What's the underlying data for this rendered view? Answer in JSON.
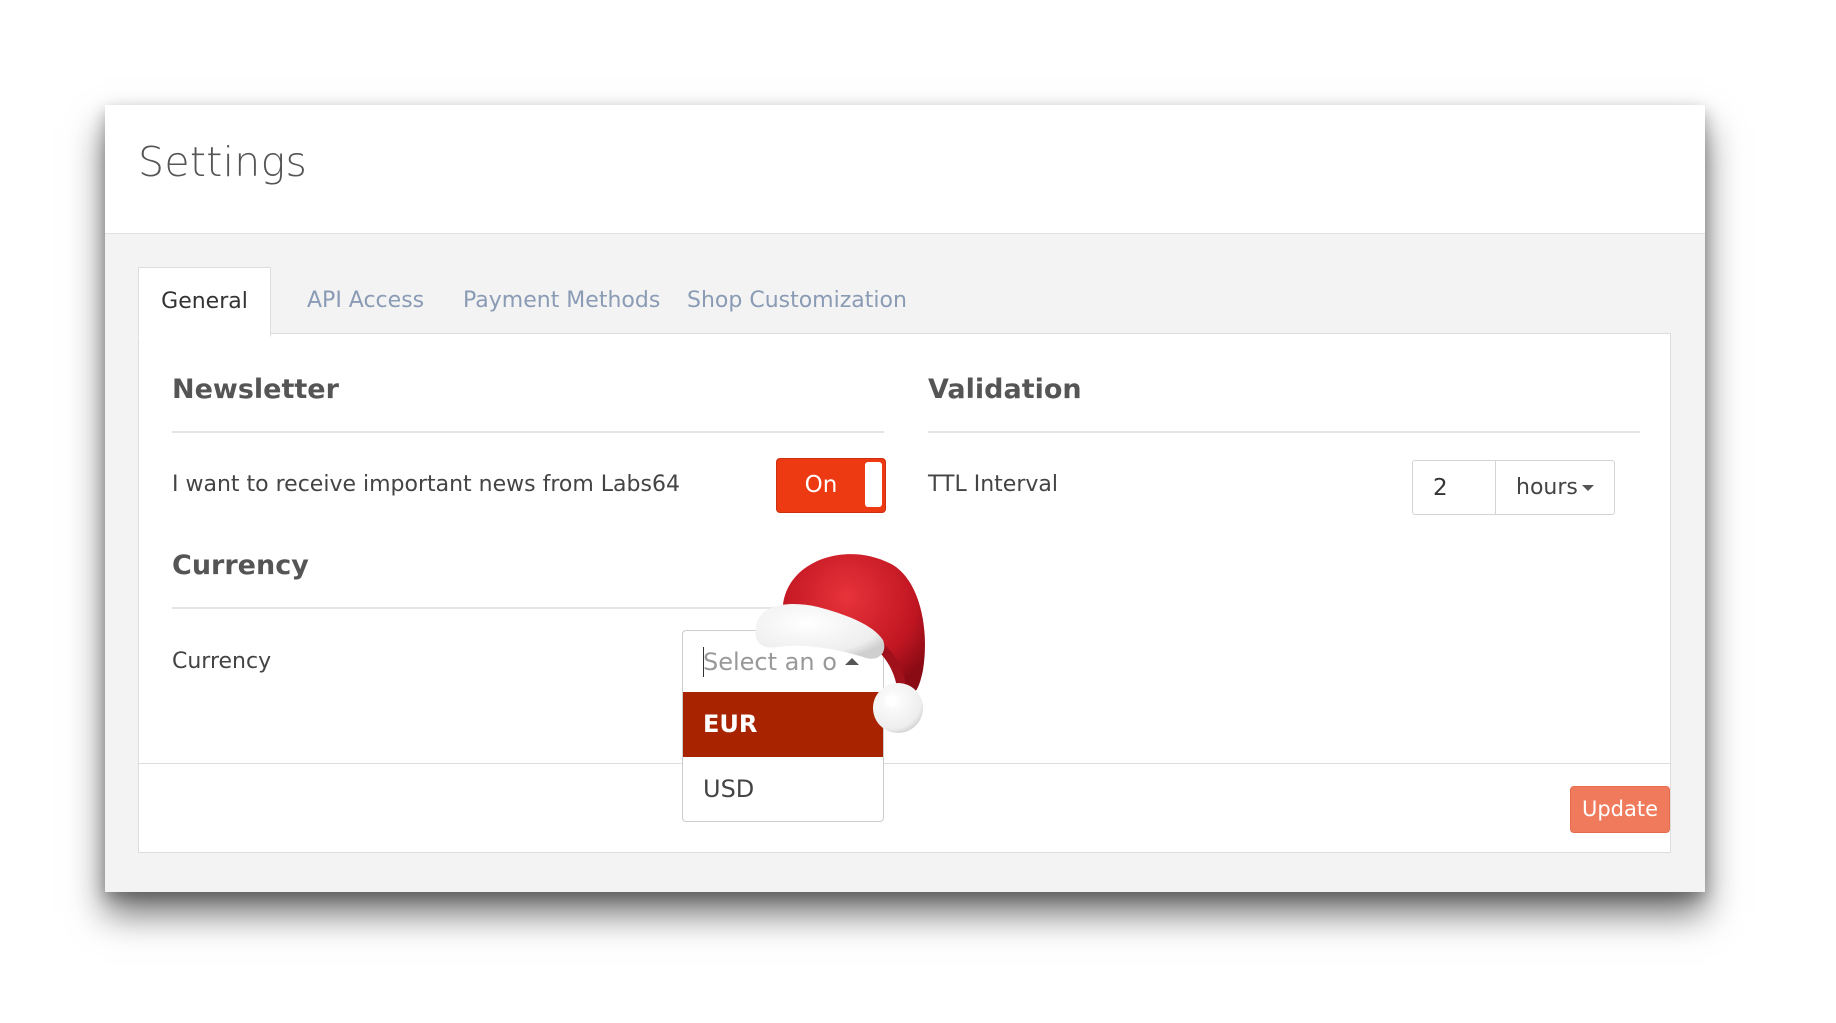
{
  "page": {
    "title": "Settings"
  },
  "tabs": [
    {
      "label": "General",
      "active": true
    },
    {
      "label": "API Access",
      "active": false
    },
    {
      "label": "Payment Methods",
      "active": false
    },
    {
      "label": "Shop Customization",
      "active": false
    }
  ],
  "newsletter": {
    "title": "Newsletter",
    "label": "I want to receive important news from Labs64",
    "toggle_label": "On"
  },
  "validation": {
    "title": "Validation",
    "label": "TTL Interval",
    "ttl_value": "2",
    "unit": "hours"
  },
  "currency": {
    "title": "Currency",
    "label": "Currency",
    "placeholder": "Select an o",
    "options": [
      "EUR",
      "USD"
    ],
    "highlighted": "EUR"
  },
  "actions": {
    "update_label": "Update"
  },
  "colors": {
    "accent": "#ee3a12",
    "highlight": "#a82400",
    "update_button": "#f07a5c",
    "tab_inactive": "#8a9bb5"
  },
  "icons": {
    "unit_dropdown": "caret-down-icon",
    "currency_dropdown": "caret-up-icon",
    "decoration": "santa-hat-icon"
  }
}
